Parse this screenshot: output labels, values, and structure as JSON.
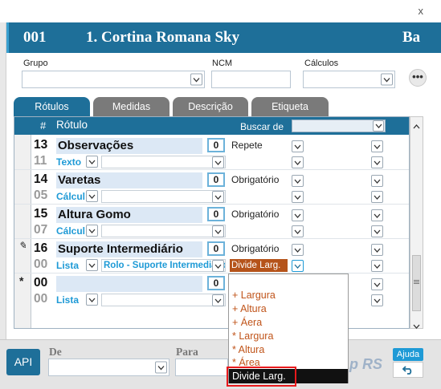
{
  "window": {
    "close_glyph": "x"
  },
  "header": {
    "code": "001",
    "title": "1. Cortina Romana Sky",
    "right_text": "Ba"
  },
  "fields": {
    "grupo_label": "Grupo",
    "ncm_label": "NCM",
    "calculos_label": "Cálculos",
    "more_label": "•••"
  },
  "tabs": [
    {
      "label": "Rótulos",
      "active": true
    },
    {
      "label": "Medidas",
      "active": false
    },
    {
      "label": "Descrição",
      "active": false
    },
    {
      "label": "Etiqueta",
      "active": false
    }
  ],
  "grid": {
    "col_num": "#",
    "col_rotulo": "Rótulo",
    "buscar_label": "Buscar de",
    "rows": [
      {
        "num": "13",
        "name": "Observações",
        "sub_num": "11",
        "type": "Texto",
        "badge": "0",
        "req": "Repete"
      },
      {
        "num": "14",
        "name": "Varetas",
        "sub_num": "05",
        "type": "Cálculo",
        "badge": "0",
        "req": "Obrigatório"
      },
      {
        "num": "15",
        "name": "Altura Gomo",
        "sub_num": "07",
        "type": "Cálculo",
        "badge": "0",
        "req": "Obrigatório"
      },
      {
        "num": "16",
        "name": "Suporte Intermediário",
        "sub_num": "00",
        "type": "Lista",
        "list_value": "Rolo - Suporte Intermediário",
        "badge": "0",
        "req": "Obrigatório",
        "calc_value": "Divide Larg."
      },
      {
        "num": "00",
        "name": "",
        "sub_num": "00",
        "type": "Lista",
        "badge": "0",
        "req": ""
      }
    ],
    "row_markers": {
      "edit": "✎",
      "new": "*"
    }
  },
  "popup": {
    "options": [
      "+ Largura",
      "+ Altura",
      "+ Áera",
      "* Largura",
      "* Altura",
      "* Área"
    ],
    "selected": "Divide Larg."
  },
  "bottom": {
    "api_label": "API",
    "de_label": "De",
    "para_label": "Para",
    "ajuda_label": "Ajuda",
    "logo_text": "p RS"
  },
  "colors": {
    "primary": "#1e6f99",
    "accent": "#1e9ad6",
    "option_text": "#c0541a",
    "highlight_border": "#e8191c"
  }
}
